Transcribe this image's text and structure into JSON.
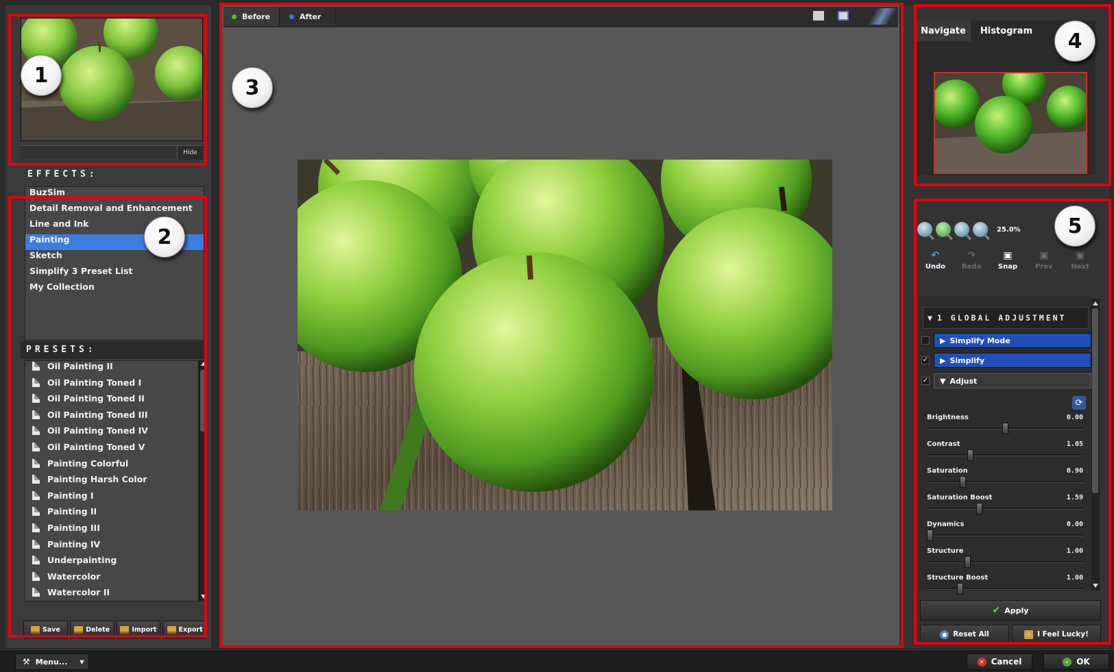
{
  "thumbnail": {
    "hide_label": "Hide"
  },
  "effects": {
    "header": "EFFECTS:",
    "items": [
      {
        "label": "BuzSim"
      },
      {
        "label": "Detail Removal and Enhancement"
      },
      {
        "label": "Line and Ink"
      },
      {
        "label": "Painting",
        "selected": true
      },
      {
        "label": "Sketch"
      },
      {
        "label": "Simplify 3 Preset List"
      },
      {
        "label": "My Collection"
      }
    ]
  },
  "presets": {
    "header": "PRESETS:",
    "items": [
      "Oil Painting II",
      "Oil Painting Toned I",
      "Oil Painting Toned II",
      "Oil Painting Toned III",
      "Oil Painting Toned IV",
      "Oil Painting Toned V",
      "Painting Colorful",
      "Painting Harsh Color",
      "Painting I",
      "Painting II",
      "Painting III",
      "Painting IV",
      "Underpainting",
      "Watercolor",
      "Watercolor II"
    ],
    "buttons": {
      "save": "Save",
      "delete": "Delete",
      "import": "Import",
      "export": "Export"
    }
  },
  "viewer": {
    "tabs": {
      "before": "Before",
      "after": "After"
    },
    "before_dot_color": "#4fc235",
    "after_dot_color": "#3b78e0"
  },
  "navigator": {
    "tabs": {
      "navigate": "Navigate",
      "histogram": "Histogram"
    }
  },
  "zoom": {
    "level": "25.0%"
  },
  "history": {
    "undo": "Undo",
    "redo": "Redo",
    "snap": "Snap",
    "prev": "Prev",
    "next": "Next"
  },
  "adjustments": {
    "header": "1 GLOBAL ADJUSTMENT",
    "groups": {
      "simplify_mode": "Simplify Mode",
      "simplify": "Simplify",
      "adjust": "Adjust"
    },
    "sliders": [
      {
        "label": "Brightness",
        "value": "0.00",
        "level": 0.5
      },
      {
        "label": "Contrast",
        "value": "1.05",
        "level": 0.27
      },
      {
        "label": "Saturation",
        "value": "0.90",
        "level": 0.22
      },
      {
        "label": "Saturation Boost",
        "value": "1.59",
        "level": 0.33
      },
      {
        "label": "Dynamics",
        "value": "0.00",
        "level": 0.0
      },
      {
        "label": "Structure",
        "value": "1.00",
        "level": 0.25
      },
      {
        "label": "Structure Boost",
        "value": "1.00",
        "level": 0.2
      }
    ],
    "apply_label": "Apply",
    "reset_label": "Reset All",
    "lucky_label": "I Feel Lucky!"
  },
  "statusbar": {
    "menu_label": "Menu...",
    "cancel_label": "Cancel",
    "ok_label": "OK"
  },
  "callouts": [
    "1",
    "2",
    "3",
    "4",
    "5"
  ],
  "colors": {
    "highlight": "#e8000b",
    "selection": "#3b7ee0",
    "group_blue": "#1f4fb8"
  }
}
